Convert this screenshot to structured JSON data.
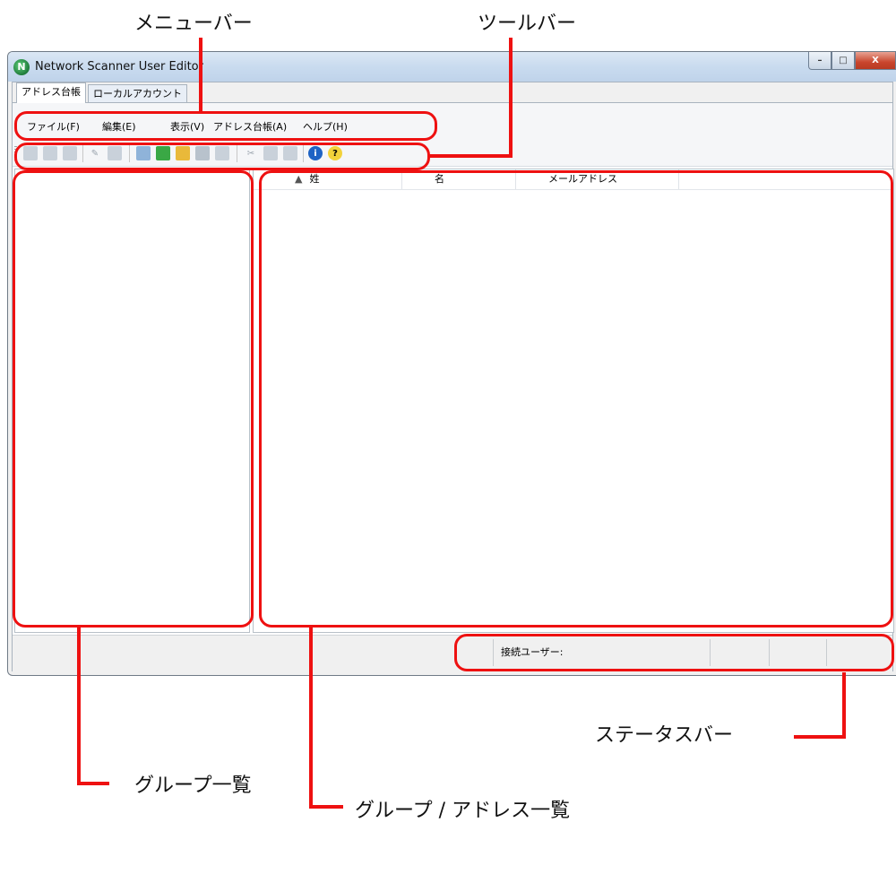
{
  "annotations": {
    "menubar": "メニューバー",
    "toolbar": "ツールバー",
    "statusbar": "ステータスバー",
    "group_address_list": "グループ / アドレス一覧",
    "group_list": "グループ一覧"
  },
  "window": {
    "title": "Network Scanner User Editor",
    "app_icon_glyph": "N",
    "controls": {
      "minimize": "–",
      "maximize": "□",
      "close": "X"
    }
  },
  "tabs": [
    "アドレス台帳",
    "ローカルアカウント"
  ],
  "menu": [
    "ファイル(F)",
    "編集(E)",
    "表示(V)",
    "アドレス台帳(A)",
    "ヘルプ(H)"
  ],
  "toolbar": {
    "icons": [
      "add-user-icon",
      "add-users-icon",
      "user-group-icon",
      "edit-icon",
      "delete-icon",
      "import-icon",
      "new-address-book-icon",
      "open-folder-icon",
      "close-address-book-icon",
      "save-icon",
      "cut-icon",
      "copy-icon",
      "paste-icon",
      "info-icon",
      "help-icon"
    ]
  },
  "address_list": {
    "sort_indicator": "▲",
    "columns": [
      "姓",
      "名",
      "メールアドレス"
    ]
  },
  "status": {
    "connected_user_label": "接続ユーザー:"
  },
  "colors": {
    "annotation": "#ee1111"
  }
}
